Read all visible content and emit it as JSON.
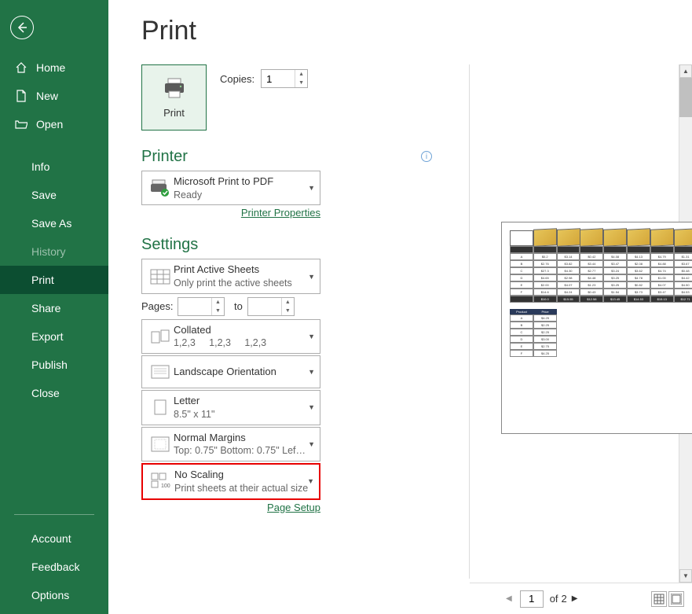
{
  "page_title": "Print",
  "sidebar": {
    "home": "Home",
    "new": "New",
    "open": "Open",
    "info": "Info",
    "save": "Save",
    "saveas": "Save As",
    "history": "History",
    "print": "Print",
    "share": "Share",
    "export": "Export",
    "publish": "Publish",
    "close": "Close",
    "account": "Account",
    "feedback": "Feedback",
    "options": "Options"
  },
  "print_button_label": "Print",
  "copies_label": "Copies:",
  "copies_value": "1",
  "printer_section": "Printer",
  "printer": {
    "name": "Microsoft Print to PDF",
    "status": "Ready"
  },
  "printer_properties": "Printer Properties",
  "settings_section": "Settings",
  "settings": {
    "active_sheets": {
      "primary": "Print Active Sheets",
      "secondary": "Only print the active sheets"
    },
    "pages_label": "Pages:",
    "pages_to": "to",
    "collated": {
      "primary": "Collated",
      "secondary": "1,2,3     1,2,3     1,2,3"
    },
    "orientation": {
      "primary": "Landscape Orientation"
    },
    "paper": {
      "primary": "Letter",
      "secondary": "8.5\" x 11\""
    },
    "margins": {
      "primary": "Normal Margins",
      "secondary": "Top: 0.75\" Bottom: 0.75\" Lef…"
    },
    "scaling": {
      "primary": "No Scaling",
      "secondary": "Print sheets at their actual size"
    }
  },
  "page_setup": "Page Setup",
  "pager": {
    "current": "1",
    "of_label": "of",
    "total": "2"
  }
}
